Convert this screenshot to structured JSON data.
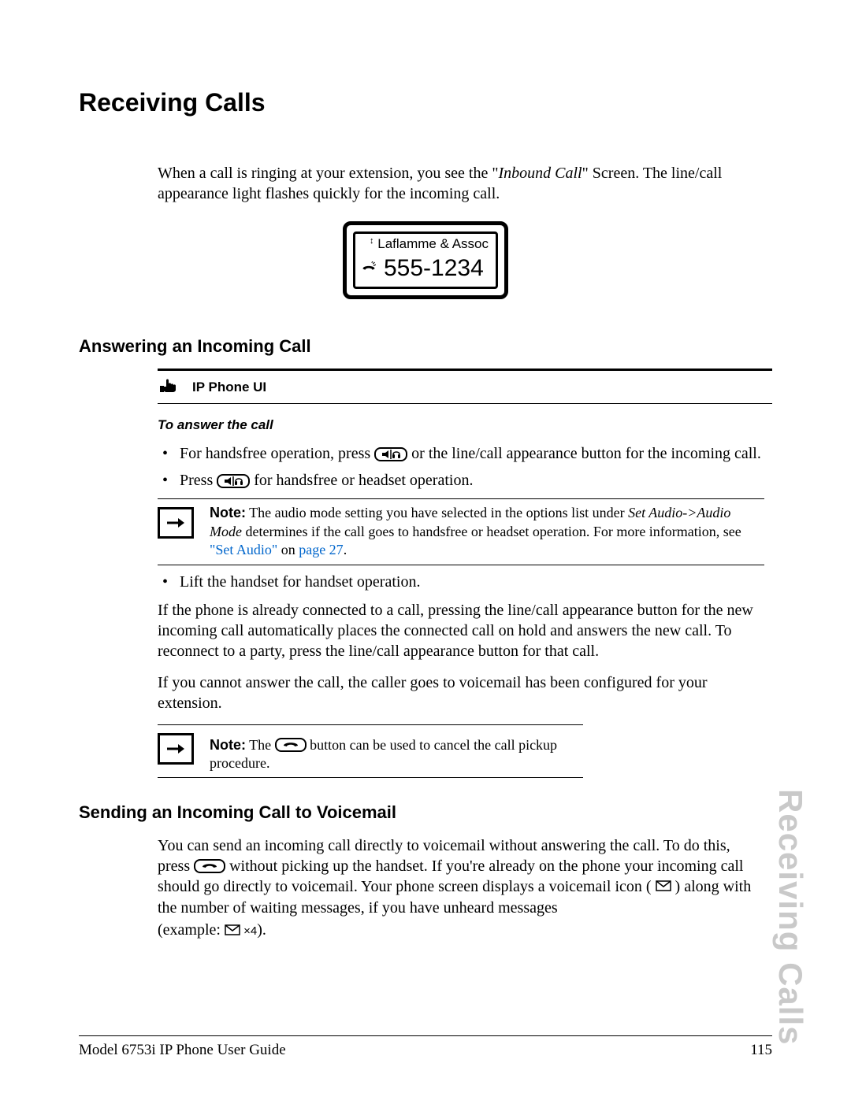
{
  "side_tab": "Receiving Calls",
  "title": "Receiving Calls",
  "intro": {
    "prefix": "When a call is ringing at your extension, you see the \"",
    "inbound": "Inbound Call",
    "suffix": "\" Screen. The line/call appearance light flashes quickly for the incoming call."
  },
  "lcd": {
    "name": "Laflamme & Assoc",
    "number": "555-1234"
  },
  "answer": {
    "heading": "Answering an Incoming Call",
    "ui_label": "IP Phone UI",
    "step_title": "To answer the call",
    "bullet1_a": "For handsfree operation, press ",
    "bullet1_b": " or the line/call appearance button for the incoming call.",
    "bullet2_a": "Press ",
    "bullet2_b": " for handsfree or headset operation.",
    "note1": {
      "label": "Note:",
      "a": " The audio mode setting you have selected in the options list under ",
      "opt": "Set Audio->Audio Mode",
      "b": " determines if the call goes to handsfree or headset operation. For more information, see ",
      "link1": "\"Set Audio\"",
      "mid": " on ",
      "link2": "page 27",
      "end": "."
    },
    "bullet3": "Lift the handset for handset operation.",
    "para1": "If the phone is already connected to a call, pressing the line/call appearance button for the new incoming call automatically places the connected call on hold and answers the new call. To reconnect to a party, press the line/call appearance button for that call.",
    "para2": "If you cannot answer the call, the caller goes to voicemail has been configured for your extension.",
    "note2": {
      "label": "Note:",
      "a": " The ",
      "b": " button can be used to cancel the call pickup procedure."
    }
  },
  "voicemail": {
    "heading": "Sending an Incoming Call to Voicemail",
    "a": "You can send an incoming call directly to voicemail without answering the call. To do this, press ",
    "b": " without picking up the handset. If you're already on the phone your incoming call should go directly to voicemail. Your phone screen displays a voicemail icon ( ",
    "c": " ) along with the number of waiting messages, if you have unheard messages",
    "d": "(example: ",
    "count": " ×4",
    "e": ")."
  },
  "footer": {
    "left": "Model 6753i IP Phone User Guide",
    "right": "115"
  }
}
